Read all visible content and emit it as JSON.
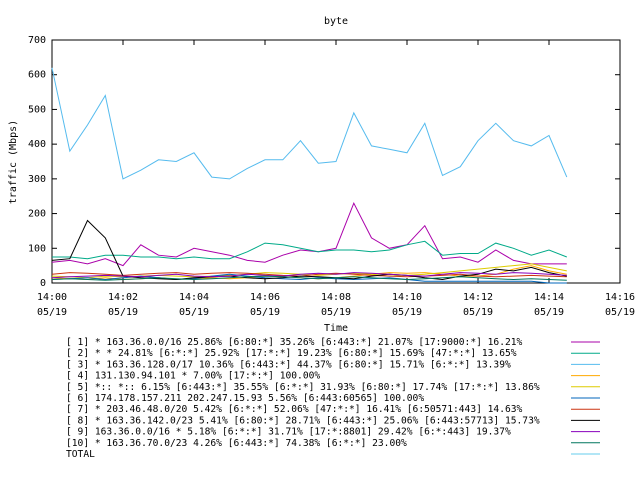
{
  "chart_data": {
    "type": "line",
    "title": "byte",
    "xlabel": "Time",
    "ylabel": "traffic (Mbps)",
    "ylim": [
      0,
      700
    ],
    "xlim": [
      "14:00",
      "14:16"
    ],
    "grid": false,
    "legend_position": "bottom",
    "y_ticks": [
      "0",
      "100",
      "200",
      "300",
      "400",
      "500",
      "600",
      "700"
    ],
    "x_ticks": [
      {
        "time": "14:00",
        "date": "05/19"
      },
      {
        "time": "14:02",
        "date": "05/19"
      },
      {
        "time": "14:04",
        "date": "05/19"
      },
      {
        "time": "14:06",
        "date": "05/19"
      },
      {
        "time": "14:08",
        "date": "05/19"
      },
      {
        "time": "14:10",
        "date": "05/19"
      },
      {
        "time": "14:12",
        "date": "05/19"
      },
      {
        "time": "14:14",
        "date": "05/19"
      },
      {
        "time": "14:16",
        "date": "05/19"
      }
    ],
    "x": [
      "14:00:00",
      "14:00:30",
      "14:01:00",
      "14:01:30",
      "14:02:00",
      "14:02:30",
      "14:03:00",
      "14:03:30",
      "14:04:00",
      "14:04:30",
      "14:05:00",
      "14:05:30",
      "14:06:00",
      "14:06:30",
      "14:07:00",
      "14:07:30",
      "14:08:00",
      "14:08:30",
      "14:09:00",
      "14:09:30",
      "14:10:00",
      "14:10:30",
      "14:11:00",
      "14:11:30",
      "14:12:00",
      "14:12:30",
      "14:13:00",
      "14:13:30",
      "14:14:00",
      "14:14:30"
    ],
    "series": [
      {
        "name": "[ 1] * 163.36.0.0/16 25.86%  [6:80:*] 35.26% [6:443:*] 21.07% [17:9000:*] 16.21%",
        "color": "#aa00aa",
        "values": [
          60,
          65,
          55,
          70,
          50,
          110,
          80,
          75,
          100,
          90,
          80,
          65,
          60,
          80,
          95,
          90,
          100,
          230,
          130,
          100,
          110,
          165,
          70,
          75,
          60,
          95,
          65,
          55,
          55,
          55
        ]
      },
      {
        "name": "[ 2] * * 24.81%  [6:*:*] 25.92% [17:*:*] 19.23% [6:80:*] 15.69% [47:*:*] 13.65%",
        "color": "#00aa88",
        "values": [
          75,
          75,
          70,
          80,
          80,
          75,
          75,
          70,
          75,
          70,
          70,
          90,
          115,
          110,
          100,
          90,
          95,
          95,
          90,
          95,
          110,
          120,
          80,
          85,
          85,
          115,
          100,
          80,
          95,
          75
        ]
      },
      {
        "name": "[ 3] * 163.36.128.0/17 10.36%  [6:443:*] 44.37% [6:80:*] 15.71% [6:*:*] 13.39%",
        "color": "#55bbee",
        "values": [
          620,
          380,
          455,
          540,
          300,
          325,
          355,
          350,
          375,
          305,
          300,
          330,
          355,
          355,
          410,
          345,
          350,
          490,
          395,
          385,
          375,
          460,
          310,
          335,
          410,
          460,
          410,
          395,
          425,
          305
        ]
      },
      {
        "name": "[ 4] 131.130.94.101 * 7.00%  [17:*:*] 100.00%",
        "color": "#ffaa00",
        "values": [
          15,
          12,
          10,
          15,
          10,
          12,
          15,
          10,
          12,
          15,
          12,
          15,
          20,
          18,
          15,
          12,
          15,
          20,
          25,
          30,
          28,
          30,
          25,
          20,
          20,
          25,
          40,
          50,
          35,
          25
        ]
      },
      {
        "name": "[ 5] *:: *:: 6.15%  [6:443:*] 35.55% [6:*:*] 31.93% [6:80:*] 17.74% [17:*:*] 13.86%",
        "color": "#ddcc00",
        "values": [
          20,
          18,
          15,
          20,
          18,
          20,
          22,
          20,
          18,
          20,
          22,
          25,
          30,
          28,
          25,
          22,
          25,
          28,
          25,
          20,
          22,
          25,
          30,
          35,
          40,
          45,
          50,
          55,
          45,
          35
        ]
      },
      {
        "name": "[ 6] 174.178.157.211 202.247.15.93 5.56%  [6:443:60565] 100.00%",
        "color": "#0066bb",
        "values": [
          10,
          12,
          15,
          10,
          15,
          20,
          15,
          10,
          12,
          20,
          25,
          20,
          15,
          12,
          10,
          15,
          12,
          10,
          12,
          15,
          10,
          5,
          5,
          5,
          5,
          5,
          5,
          5,
          0,
          0
        ]
      },
      {
        "name": "[ 7] * 203.46.48.0/20 5.42%  [6:*:*] 52.06% [47:*:*] 16.41% [6:50571:443] 14.63%",
        "color": "#cc3311",
        "values": [
          25,
          30,
          28,
          25,
          22,
          25,
          28,
          30,
          25,
          28,
          30,
          28,
          25,
          22,
          20,
          25,
          28,
          25,
          22,
          20,
          18,
          20,
          22,
          25,
          20,
          18,
          20,
          22,
          20,
          18
        ]
      },
      {
        "name": "[ 8] * 163.36.142.0/23 5.41%  [6:80:*] 28.71% [6:443:*] 25.06% [6:443:57713] 15.73%",
        "color": "#000000",
        "values": [
          65,
          70,
          180,
          130,
          20,
          15,
          12,
          10,
          15,
          18,
          20,
          15,
          12,
          15,
          20,
          18,
          15,
          12,
          20,
          25,
          22,
          15,
          10,
          20,
          25,
          40,
          35,
          45,
          30,
          20
        ]
      },
      {
        "name": "[ 9] 163.36.0.0/16 * 5.18%  [6:*:*] 31.71% [17:*:8801] 29.42% [6:*:443] 19.37%",
        "color": "#8800bb",
        "values": [
          15,
          18,
          20,
          22,
          20,
          18,
          22,
          25,
          20,
          18,
          20,
          25,
          22,
          20,
          25,
          28,
          25,
          30,
          28,
          25,
          22,
          20,
          25,
          30,
          28,
          25,
          30,
          28,
          25,
          22
        ]
      },
      {
        "name": "[10] * 163.36.70.0/23 4.26%  [6:443:*] 74.38% [6:*:*] 23.00%",
        "color": "#00775e",
        "values": [
          10,
          12,
          10,
          8,
          10,
          12,
          15,
          12,
          10,
          12,
          15,
          18,
          20,
          18,
          15,
          12,
          15,
          18,
          15,
          12,
          10,
          12,
          15,
          18,
          15,
          12,
          10,
          12,
          10,
          8
        ]
      },
      {
        "name": "TOTAL",
        "color": "#66ccee",
        "values": []
      }
    ]
  }
}
